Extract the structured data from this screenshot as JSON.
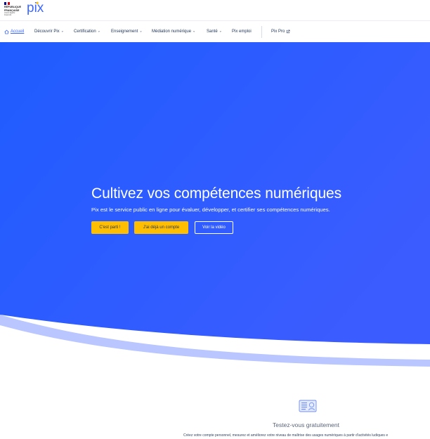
{
  "brand": {
    "gov_name_line1": "RÉPUBLIQUE",
    "gov_name_line2": "FRANÇAISE",
    "gov_motto": "Liberté Égalité Fraternité",
    "logo_text": "pix"
  },
  "nav": {
    "items": [
      {
        "label": "Accueil",
        "icon": "home-icon",
        "active": true
      },
      {
        "label": "Découvrir Pix",
        "dropdown": true
      },
      {
        "label": "Certification",
        "dropdown": true
      },
      {
        "label": "Enseignement",
        "dropdown": true
      },
      {
        "label": "Médiation numérique",
        "dropdown": true
      },
      {
        "label": "Santé",
        "dropdown": true
      },
      {
        "label": "Pix emploi"
      },
      {
        "label": "Pix Pro",
        "icon": "external-link-icon"
      }
    ]
  },
  "hero": {
    "title": "Cultivez vos compétences numériques",
    "subtitle": "Pix est le service public en ligne pour évaluer, développer, et certifier ses compétences numériques.",
    "buttons": {
      "start": "C'est parti !",
      "login": "J'ai déjà un compte",
      "video": "Voir la vidéo"
    }
  },
  "feature": {
    "icon": "profile-card-icon",
    "title": "Testez-vous gratuitement",
    "text": "Créez votre compte personnel, mesurez et améliorez votre niveau de maîtrise des usages numériques à partir d'activités ludiques e"
  },
  "colors": {
    "hero_start": "#1f5cff",
    "hero_end": "#3b63ff",
    "accent_yellow": "#ffbe00",
    "nav_active": "#3d68ff",
    "text_dark": "#253858"
  }
}
